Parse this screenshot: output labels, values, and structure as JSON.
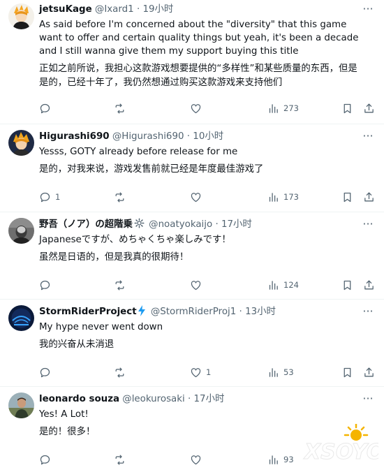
{
  "tweets": [
    {
      "name": "jetsuKage",
      "badge": "",
      "handle": "@Ixard1",
      "time": "19小时",
      "text_en": "As said before I'm concerned about the \"diversity\" that this game want to offer and certain quality things but yeah, it's been a decade and I still wanna give them my support buying this title",
      "text_zh": "正如之前所说，我担心这款游戏想要提供的“多样性”和某些质量的东西，但是是的，已经十年了，我仍然想通过购买这款游戏来支持他们",
      "replies": "",
      "likes": "",
      "views": "273"
    },
    {
      "name": "Higurashi690",
      "badge": "",
      "handle": "@Higurashi690",
      "time": "10小时",
      "text_en": "Yesss, GOTY already before release for me",
      "text_zh": "是的，对我来说，游戏发售前就已经是年度最佳游戏了",
      "replies": "1",
      "likes": "",
      "views": "173"
    },
    {
      "name": "野吾（ノア）の超階乗",
      "badge": "gear",
      "handle": "@noatyokaijo",
      "time": "17小时",
      "text_en": "Japaneseですが、めちゃくちゃ楽しみです！",
      "text_zh": "虽然是日语的，但是我真的很期待！",
      "replies": "",
      "likes": "",
      "views": "124"
    },
    {
      "name": "StormRiderProject",
      "badge": "lightning",
      "handle": "@StormRiderProj1",
      "time": "13小时",
      "text_en": "My hype never went down",
      "text_zh": "我的兴奋从未消退",
      "replies": "",
      "likes": "1",
      "views": "53"
    },
    {
      "name": "leonardo souza",
      "badge": "",
      "handle": "@leokurosaki",
      "time": "17小时",
      "text_en": "Yes! A Lot!",
      "text_zh": "是的！很多！",
      "replies": "",
      "likes": "",
      "views": "93"
    }
  ],
  "separator": "·",
  "watermark_text": "XSOYO",
  "icons": {
    "reply": "reply-icon",
    "retweet": "retweet-icon",
    "like": "heart-icon",
    "views": "views-icon",
    "bookmark": "bookmark-icon",
    "share": "share-icon",
    "more": "more-icon"
  },
  "colors": {
    "text": "#0f1419",
    "secondary": "#536471",
    "divider": "#eff3f4",
    "lightning": "#1d9bf0"
  }
}
